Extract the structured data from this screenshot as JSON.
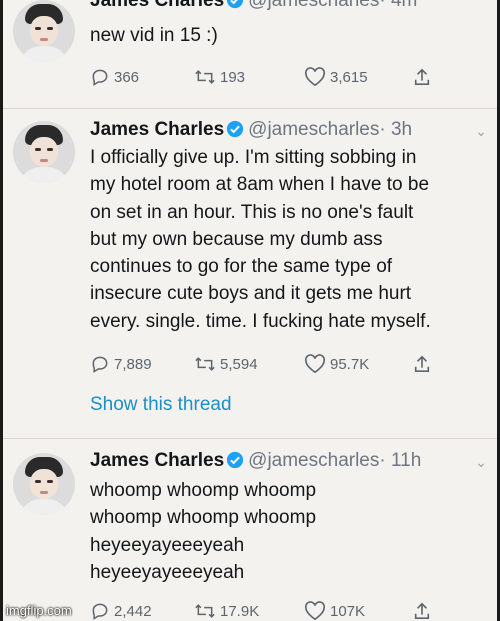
{
  "tweets": [
    {
      "name": "James Charles",
      "handle": "@jamescharles",
      "time": "· 4m",
      "lines": [
        "new vid in 15 :)"
      ],
      "replies": "366",
      "retweets": "193",
      "likes": "3,615"
    },
    {
      "name": "James Charles",
      "handle": "@jamescharles",
      "time": "· 3h",
      "lines": [
        "I officially give up. I'm sitting sobbing in",
        "my hotel room at 8am when I have to be",
        "on set in an hour. This is no one's fault",
        "but my own because my dumb ass",
        "continues to go for the same type of",
        "insecure cute boys and it gets me hurt",
        "every. single. time. I fucking hate myself."
      ],
      "replies": "7,889",
      "retweets": "5,594",
      "likes": "95.7K",
      "show_thread": "Show this thread"
    },
    {
      "name": "James Charles",
      "handle": "@jamescharles",
      "time": "· 11h",
      "lines": [
        "whoomp whoomp whoomp",
        "whoomp whoomp whoomp",
        "heyeeyayeeeyeah",
        "heyeeyayeeeyeah"
      ],
      "replies": "2,442",
      "retweets": "17.9K",
      "likes": "107K"
    }
  ],
  "watermark": "imgflip.com",
  "colors": {
    "link": "#1d8ec7",
    "verified": "#1da1f2",
    "background": "#f4f2ee"
  }
}
